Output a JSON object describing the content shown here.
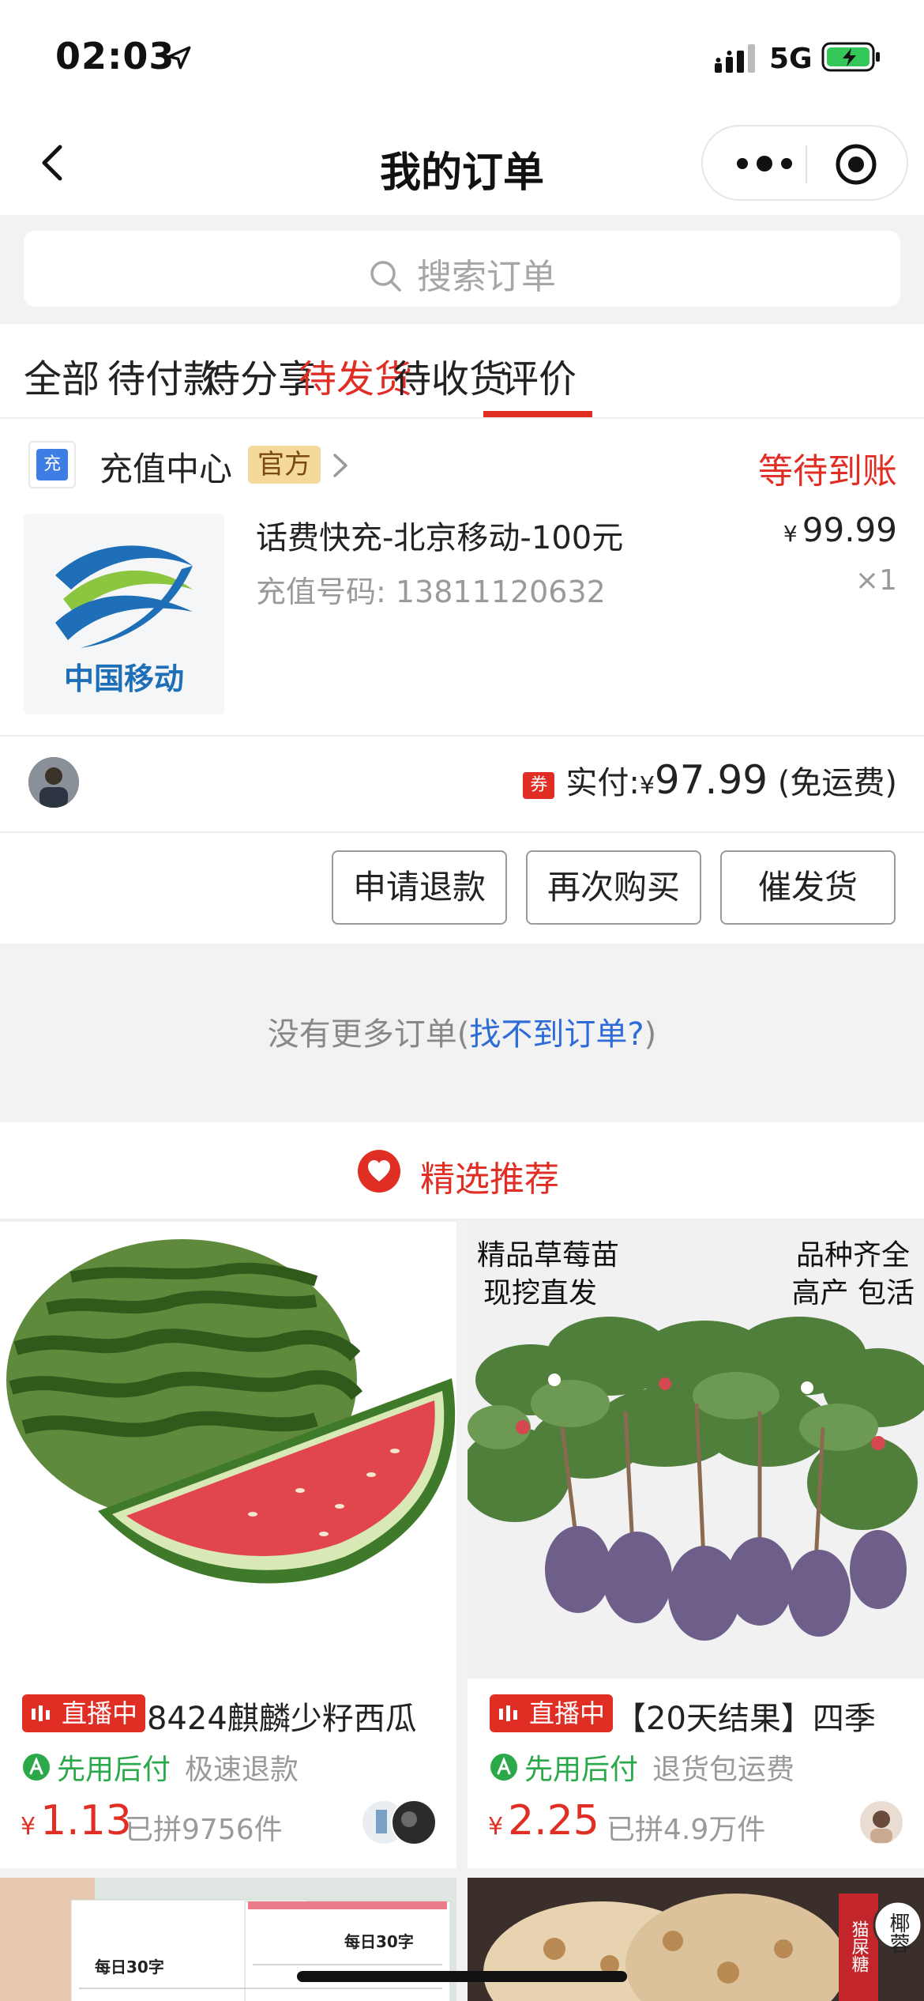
{
  "status_bar": {
    "time": "02:03",
    "network": "5G"
  },
  "nav": {
    "title": "我的订单"
  },
  "search": {
    "placeholder": "搜索订单"
  },
  "tabs": [
    {
      "label": "全部",
      "active": false
    },
    {
      "label": "待付款",
      "active": false
    },
    {
      "label": "待分享",
      "active": false
    },
    {
      "label": "待发货",
      "active": true
    },
    {
      "label": "待收货",
      "active": false
    },
    {
      "label": "评价",
      "active": false
    }
  ],
  "order": {
    "store_icon_char": "充",
    "store_name": "充值中心",
    "official_badge": "官方",
    "status": "等待到账",
    "product_logo_text": "中国移动",
    "product_title": "话费快充-北京移动-100元",
    "product_sub": "充值号码: 13811120632",
    "price_symbol": "¥",
    "price": "99.99",
    "quantity": "×1",
    "coupon_label": "券",
    "paid_label": "实付:",
    "paid_symbol": "¥",
    "paid_amount": "97.99",
    "shipping_note": "(免运费)",
    "buttons": {
      "refund": "申请退款",
      "rebuy": "再次购买",
      "urge": "催发货"
    }
  },
  "no_more": {
    "text": "没有更多订单(",
    "link": "找不到订单?",
    "close": ")"
  },
  "recommend": {
    "title": "精选推荐",
    "items": [
      {
        "live": "直播中",
        "title": "8424麒麟少籽西瓜",
        "pay_later": "先用后付",
        "tag": "极速退款",
        "price_symbol": "¥",
        "price": "1.13",
        "sold": "已拼9756件"
      },
      {
        "live": "直播中",
        "title": "【20天结果】四季",
        "pay_later": "先用后付",
        "tag": "退货包运费",
        "price_symbol": "¥",
        "price": "2.25",
        "sold": "已拼4.9万件",
        "image_text": {
          "left_line1": "精品草莓苗",
          "left_line2": "现挖直发",
          "right_line1": "品种齐全",
          "right_line2": "高产 包活"
        }
      }
    ],
    "bottom_items": [
      {
        "image_text": "每日30字"
      },
      {
        "image_text_1": "猫屎糖",
        "image_text_2": "椰蓉"
      }
    ]
  },
  "colors": {
    "accent": "#e02e24",
    "link": "#2d6bd6",
    "green": "#2aa84a"
  }
}
